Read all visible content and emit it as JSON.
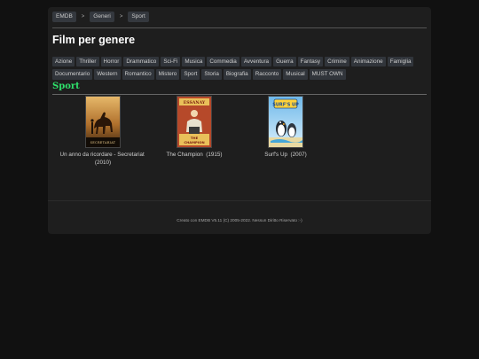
{
  "breadcrumb": {
    "items": [
      "EMDB",
      "Generi",
      "Sport"
    ],
    "separator": ">"
  },
  "page_title": "Film per genere",
  "genres": [
    "Azione",
    "Thriller",
    "Horror",
    "Drammatico",
    "Sci-Fi",
    "Musica",
    "Commedia",
    "Avventura",
    "Guerra",
    "Fantasy",
    "Crimine",
    "Animazione",
    "Famiglia",
    "Documentario",
    "Western",
    "Romantico",
    "Mistero",
    "Sport",
    "Storia",
    "Biografia",
    "Racconto",
    "Musical",
    "MUST OWN"
  ],
  "section_title": "Sport",
  "films": [
    {
      "title": "Un anno da ricordare - Secretariat",
      "year": "(2010)",
      "poster_text": "SECRETARIAT"
    },
    {
      "title": "The Champion",
      "year": "(1915)",
      "poster_text": "THE CHAMPION"
    },
    {
      "title": "Surf's Up",
      "year": "(2007)",
      "poster_text": "SURF'S UP"
    }
  ],
  "footer": "Creato con EMDB V5.11 (C) 2005-2022. Nessun Diritto Riservato :-)",
  "colors": {
    "background": "#111111",
    "panel": "#1e1e1e",
    "tag": "#31353b",
    "section_accent": "#2ee06a"
  }
}
